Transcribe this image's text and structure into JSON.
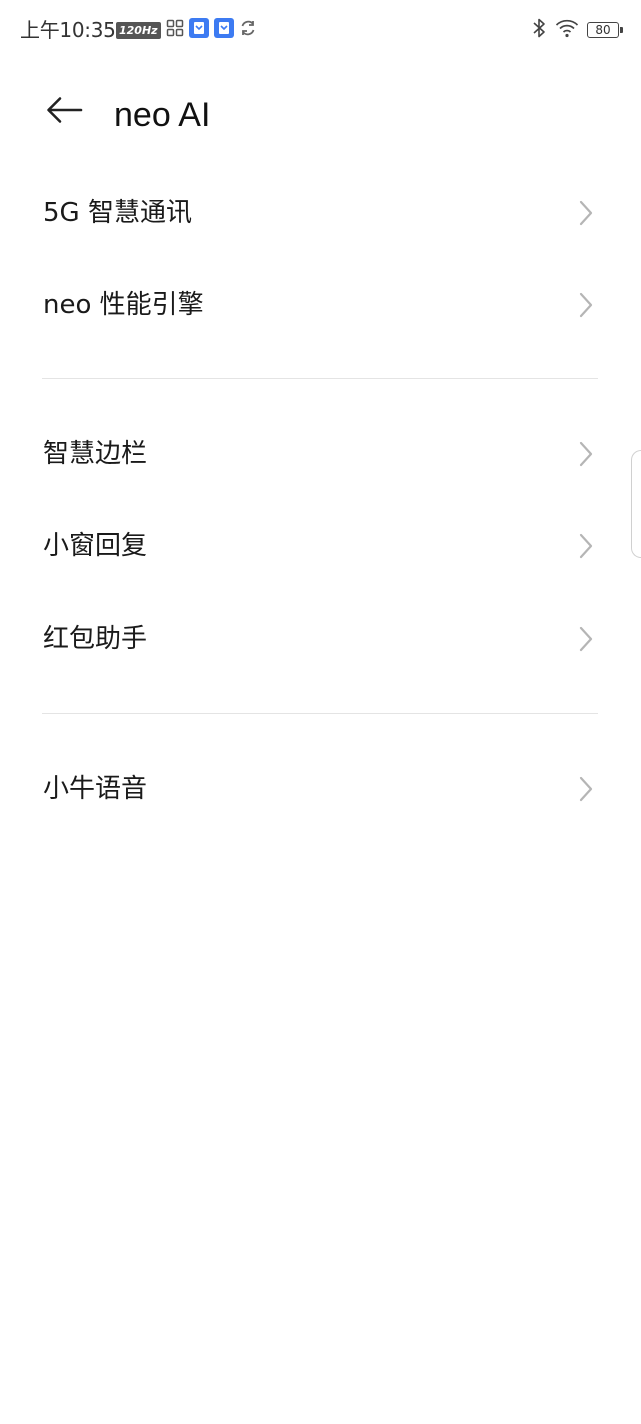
{
  "status_bar": {
    "time": "上午10:35",
    "refresh_rate_badge": "120Hz",
    "battery_level": "80",
    "left_icons": [
      "refresh-rate-badge",
      "app-grid-icon",
      "notification-app-icon",
      "notification-app-icon",
      "sync-icon"
    ],
    "right_icons": [
      "bluetooth-icon",
      "wifi-icon",
      "battery-icon"
    ]
  },
  "header": {
    "back_icon": "arrow-left-icon",
    "title": "neo AI"
  },
  "menu_groups": [
    {
      "items": [
        {
          "label": "5G 智慧通讯",
          "icon": "chevron-right-icon"
        },
        {
          "label": "neo 性能引擎",
          "icon": "chevron-right-icon"
        }
      ]
    },
    {
      "items": [
        {
          "label": "智慧边栏",
          "icon": "chevron-right-icon"
        },
        {
          "label": "小窗回复",
          "icon": "chevron-right-icon"
        },
        {
          "label": "红包助手",
          "icon": "chevron-right-icon"
        }
      ]
    },
    {
      "items": [
        {
          "label": "小牛语音",
          "icon": "chevron-right-icon"
        }
      ]
    }
  ],
  "colors": {
    "background": "#ffffff",
    "text_primary": "#1a1a1a",
    "chevron": "#b5b5b5",
    "divider": "#e4e4e4",
    "notification_icon_blue": "#3d7bf2"
  }
}
